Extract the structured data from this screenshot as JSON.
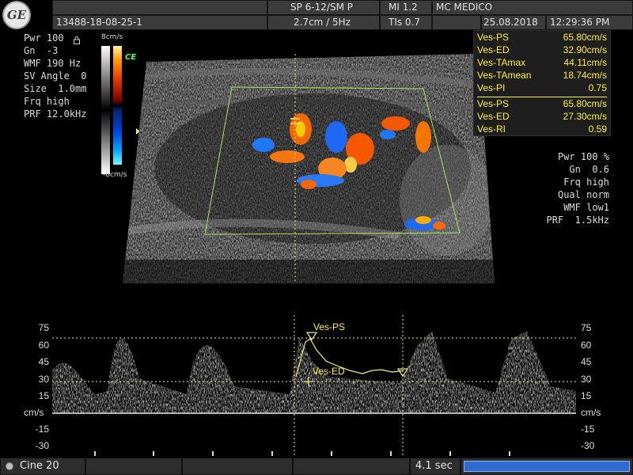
{
  "header": {
    "logo_text": "GE",
    "patient_id": "13488-18-08-25-1",
    "probe_preset": "SP 6-12/SM P",
    "depth_freq": "2.7cm / 5Hz",
    "mi": "MI  1.2",
    "tis": "TIs  0.7",
    "institution": "MC MEDICO",
    "date": "25.08.2018",
    "time": "12:29:36 PM"
  },
  "left_params": [
    "Pwr 100",
    "Gn  -3",
    "WMF 190 Hz",
    "SV Angle  0",
    "Size  1.0mm",
    "Frq high",
    "PRF 12.0kHz"
  ],
  "color_scale": {
    "top_label": "8cm/s",
    "bottom_label": "-8cm/s",
    "ce_badge": "CE"
  },
  "measurements": {
    "group1": [
      {
        "label": "Ves-PS",
        "value": "65.80cm/s"
      },
      {
        "label": "Ves-ED",
        "value": "32.90cm/s"
      },
      {
        "label": "Ves-TAmax",
        "value": "44.11cm/s"
      },
      {
        "label": "Ves-TAmean",
        "value": "18.74cm/s"
      },
      {
        "label": "Ves-PI",
        "value": "0.75"
      }
    ],
    "group2": [
      {
        "label": "Ves-PS",
        "value": "65.80cm/s"
      },
      {
        "label": "Ves-ED",
        "value": "27.30cm/s"
      },
      {
        "label": "Ves-RI",
        "value": "0.59"
      }
    ]
  },
  "right_params": [
    "Pwr 100 %",
    "Gn  0.6",
    "Frq high",
    "Qual norm",
    "WMF low1",
    "PRF  1.5kHz"
  ],
  "spectrum": {
    "ticks": [
      "75",
      "60",
      "45",
      "30",
      "15",
      "cm/s",
      "-15",
      "-30"
    ],
    "ps_marker": "Ves-PS",
    "ed_marker": "Ves-ED"
  },
  "footer": {
    "cine": "Cine 20",
    "duration": "4.1 sec",
    "cine_progress": 1.0
  },
  "colors": {
    "header_bg": "#3b3b3b",
    "measure_text": "#ffef3a",
    "roi_box": "#a6e35c",
    "cine_bar": "#2e6bd1",
    "doppler_red": "#ff5a00",
    "doppler_blue": "#1e7dff"
  }
}
